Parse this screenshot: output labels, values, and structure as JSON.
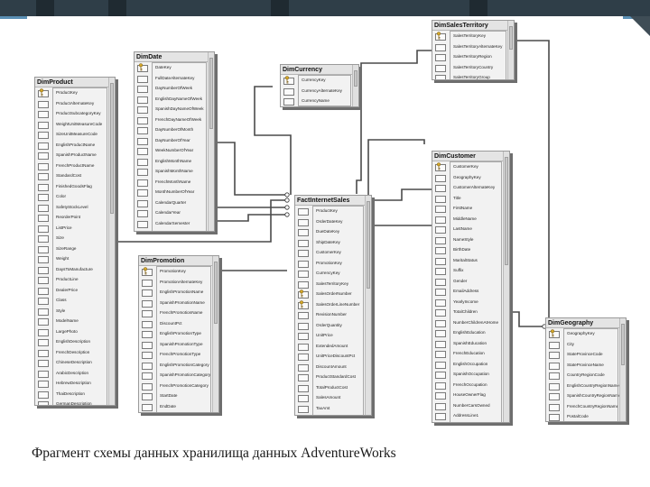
{
  "caption": "Фрагмент схемы данных хранилища данных AdventureWorks",
  "tables": [
    {
      "id": "dim-product",
      "name": "DimProduct",
      "key_columns": [
        "ProductKey"
      ],
      "columns": [
        "ProductKey",
        "ProductAlternateKey",
        "ProductSubcategoryKey",
        "WeightUnitMeasureCode",
        "SizeUnitMeasureCode",
        "EnglishProductName",
        "SpanishProductName",
        "FrenchProductName",
        "StandardCost",
        "FinishedGoodsFlag",
        "Color",
        "SafetyStockLevel",
        "ReorderPoint",
        "ListPrice",
        "Size",
        "SizeRange",
        "Weight",
        "DaysToManufacture",
        "ProductLine",
        "DealerPrice",
        "Class",
        "Style",
        "ModelName",
        "LargePhoto",
        "EnglishDescription",
        "FrenchDescription",
        "ChineseDescription",
        "ArabicDescription",
        "HebrewDescription",
        "ThaiDescription",
        "GermanDescription",
        "JapaneseDescription",
        "TurkishDescription",
        "StartDate"
      ]
    },
    {
      "id": "dim-date",
      "name": "DimDate",
      "key_columns": [
        "DateKey"
      ],
      "columns": [
        "DateKey",
        "FullDateAlternateKey",
        "DayNumberOfWeek",
        "EnglishDayNameOfWeek",
        "SpanishDayNameOfWeek",
        "FrenchDayNameOfWeek",
        "DayNumberOfMonth",
        "DayNumberOfYear",
        "WeekNumberOfYear",
        "EnglishMonthName",
        "SpanishMonthName",
        "FrenchMonthName",
        "MonthNumberOfYear",
        "CalendarQuarter",
        "CalendarYear",
        "CalendarSemester",
        "FiscalQuarter",
        "FiscalYear"
      ]
    },
    {
      "id": "dim-currency",
      "name": "DimCurrency",
      "key_columns": [
        "CurrencyKey"
      ],
      "columns": [
        "CurrencyKey",
        "CurrencyAlternateKey",
        "CurrencyName"
      ]
    },
    {
      "id": "dim-sales-territory",
      "name": "DimSalesTerritory",
      "key_columns": [
        "SalesTerritoryKey"
      ],
      "columns": [
        "SalesTerritoryKey",
        "SalesTerritoryAlternateKey",
        "SalesTerritoryRegion",
        "SalesTerritoryCountry",
        "SalesTerritoryGroup"
      ]
    },
    {
      "id": "fact-internet-sales",
      "name": "FactInternetSales",
      "key_columns": [
        "SalesOrderNumber",
        "SalesOrderLineNumber"
      ],
      "columns": [
        "ProductKey",
        "OrderDateKey",
        "DueDateKey",
        "ShipDateKey",
        "CustomerKey",
        "PromotionKey",
        "CurrencyKey",
        "SalesTerritoryKey",
        "SalesOrderNumber",
        "SalesOrderLineNumber",
        "RevisionNumber",
        "OrderQuantity",
        "UnitPrice",
        "ExtendedAmount",
        "UnitPriceDiscountPct",
        "DiscountAmount",
        "ProductStandardCost",
        "TotalProductCost",
        "SalesAmount",
        "TaxAmt",
        "Freight",
        "CarrierTrackingNumber"
      ]
    },
    {
      "id": "dim-promotion",
      "name": "DimPromotion",
      "key_columns": [
        "PromotionKey"
      ],
      "columns": [
        "PromotionKey",
        "PromotionAlternateKey",
        "EnglishPromotionName",
        "SpanishPromotionName",
        "FrenchPromotionName",
        "DiscountPct",
        "EnglishPromotionType",
        "SpanishPromotionType",
        "FrenchPromotionType",
        "EnglishPromotionCategory",
        "SpanishPromotionCategory",
        "FrenchPromotionCategory",
        "StartDate",
        "EndDate",
        "MinQty",
        "MaxQty"
      ]
    },
    {
      "id": "dim-customer",
      "name": "DimCustomer",
      "key_columns": [
        "CustomerKey"
      ],
      "columns": [
        "CustomerKey",
        "GeographyKey",
        "CustomerAlternateKey",
        "Title",
        "FirstName",
        "MiddleName",
        "LastName",
        "NameStyle",
        "BirthDate",
        "MaritalStatus",
        "Suffix",
        "Gender",
        "EmailAddress",
        "YearlyIncome",
        "TotalChildren",
        "NumberChildrenAtHome",
        "EnglishEducation",
        "SpanishEducation",
        "FrenchEducation",
        "EnglishOccupation",
        "SpanishOccupation",
        "FrenchOccupation",
        "HouseOwnerFlag",
        "NumberCarsOwned",
        "AddressLine1",
        "AddressLine2",
        "Phone",
        "DateFirstPurchase"
      ]
    },
    {
      "id": "dim-geography",
      "name": "DimGeography",
      "key_columns": [
        "GeographyKey"
      ],
      "columns": [
        "GeographyKey",
        "City",
        "StateProvinceCode",
        "StateProvinceName",
        "CountryRegionCode",
        "EnglishCountryRegionName",
        "SpanishCountryRegionName",
        "FrenchCountryRegionName",
        "PostalCode",
        "SalesTerritoryKey"
      ]
    }
  ]
}
